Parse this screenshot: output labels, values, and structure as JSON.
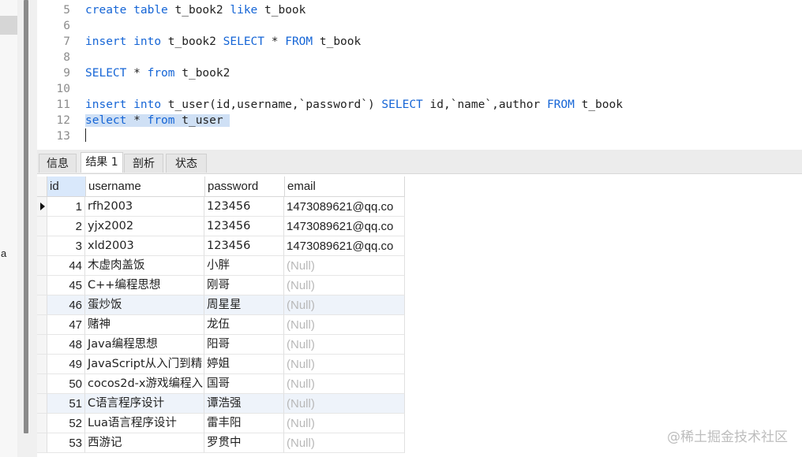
{
  "editor": {
    "lines": [
      {
        "n": "5",
        "parts": [
          [
            "kw",
            "create"
          ],
          [
            "tx",
            " "
          ],
          [
            "kw",
            "table"
          ],
          [
            "tx",
            " t_book2 "
          ],
          [
            "kw",
            "like"
          ],
          [
            "tx",
            " t_book"
          ]
        ]
      },
      {
        "n": "6",
        "parts": []
      },
      {
        "n": "7",
        "parts": [
          [
            "kw",
            "insert"
          ],
          [
            "tx",
            " "
          ],
          [
            "kw",
            "into"
          ],
          [
            "tx",
            " t_book2 "
          ],
          [
            "kw",
            "SELECT"
          ],
          [
            "tx",
            " * "
          ],
          [
            "kw",
            "FROM"
          ],
          [
            "tx",
            " t_book"
          ]
        ]
      },
      {
        "n": "8",
        "parts": []
      },
      {
        "n": "9",
        "parts": [
          [
            "kw",
            "SELECT"
          ],
          [
            "tx",
            " * "
          ],
          [
            "kw",
            "from"
          ],
          [
            "tx",
            " t_book2"
          ]
        ]
      },
      {
        "n": "10",
        "parts": []
      },
      {
        "n": "11",
        "parts": [
          [
            "kw",
            "insert"
          ],
          [
            "tx",
            " "
          ],
          [
            "kw",
            "into"
          ],
          [
            "tx",
            " t_user(id,username,`password`) "
          ],
          [
            "kw",
            "SELECT"
          ],
          [
            "tx",
            " id,`name`,author "
          ],
          [
            "kw",
            "FROM"
          ],
          [
            "tx",
            " t_book"
          ]
        ]
      },
      {
        "n": "12",
        "highlight": true,
        "parts": [
          [
            "kw",
            "select"
          ],
          [
            "tx",
            " * "
          ],
          [
            "kw",
            "from"
          ],
          [
            "tx",
            " t_user "
          ]
        ]
      },
      {
        "n": "13",
        "parts": []
      }
    ]
  },
  "tabs": [
    {
      "label": "信息",
      "active": false
    },
    {
      "label": "结果 1",
      "active": true
    },
    {
      "label": "剖析",
      "active": false
    },
    {
      "label": "状态",
      "active": false
    }
  ],
  "grid": {
    "columns": [
      "id",
      "username",
      "password",
      "email"
    ],
    "null_text": "(Null)",
    "rows": [
      {
        "id": "1",
        "username": "rfh2003",
        "password": "123456",
        "email": "1473089621@qq.co"
      },
      {
        "id": "2",
        "username": "yjx2002",
        "password": "123456",
        "email": "1473089621@qq.co"
      },
      {
        "id": "3",
        "username": "xld2003",
        "password": "123456",
        "email": "1473089621@qq.co"
      },
      {
        "id": "44",
        "username": "木虚肉盖饭",
        "password": "小胖",
        "email": null
      },
      {
        "id": "45",
        "username": "C++编程思想",
        "password": "刚哥",
        "email": null
      },
      {
        "id": "46",
        "username": "蛋炒饭",
        "password": "周星星",
        "email": null
      },
      {
        "id": "47",
        "username": "赌神",
        "password": "龙伍",
        "email": null
      },
      {
        "id": "48",
        "username": "Java编程思想",
        "password": "阳哥",
        "email": null
      },
      {
        "id": "49",
        "username": "JavaScript从入门到精",
        "password": "婷姐",
        "email": null
      },
      {
        "id": "50",
        "username": "cocos2d-x游戏编程入",
        "password": "国哥",
        "email": null
      },
      {
        "id": "51",
        "username": "C语言程序设计",
        "password": "谭浩强",
        "email": null
      },
      {
        "id": "52",
        "username": "Lua语言程序设计",
        "password": "雷丰阳",
        "email": null
      },
      {
        "id": "53",
        "username": "西游记",
        "password": "罗贯中",
        "email": null
      }
    ]
  },
  "left_panel": {
    "text": "a"
  },
  "watermark": "@稀土掘金技术社区"
}
